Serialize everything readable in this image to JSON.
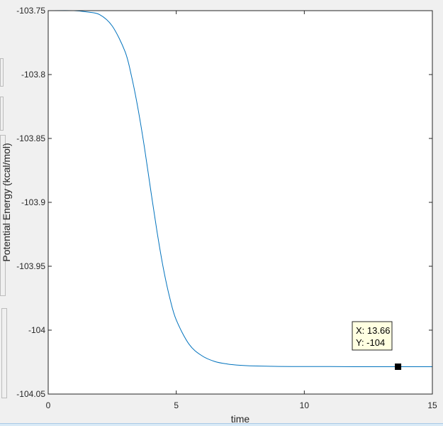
{
  "chart_data": {
    "type": "line",
    "title": "",
    "xlabel": "time",
    "ylabel": "Potential Energy (kcal/mol)",
    "xlim": [
      0,
      15
    ],
    "ylim": [
      -104.05,
      -103.75
    ],
    "xticks": [
      0,
      5,
      10,
      15
    ],
    "yticks": [
      -103.75,
      -103.8,
      -103.85,
      -103.9,
      -103.95,
      -104,
      -104.05
    ],
    "xtick_labels": [
      "0",
      "5",
      "10",
      "15"
    ],
    "ytick_labels": [
      "-103.75",
      "-103.8",
      "-103.85",
      "-103.9",
      "-103.95",
      "-104",
      "-104.05"
    ],
    "grid": false,
    "series": [
      {
        "color": "#0072bd",
        "x": [
          0,
          1,
          1.5,
          2,
          2.5,
          3,
          3.25,
          3.5,
          3.75,
          4,
          4.25,
          4.5,
          4.75,
          5,
          5.5,
          6,
          6.5,
          7,
          7.5,
          8,
          9,
          10,
          11,
          12,
          13,
          14,
          15
        ],
        "y": [
          -103.75,
          -103.75,
          -103.751,
          -103.753,
          -103.762,
          -103.782,
          -103.801,
          -103.826,
          -103.856,
          -103.89,
          -103.923,
          -103.952,
          -103.975,
          -103.992,
          -104.011,
          -104.02,
          -104.0245,
          -104.0265,
          -104.0275,
          -104.028,
          -104.0284,
          -104.0285,
          -104.0285,
          -104.0286,
          -104.0286,
          -104.0286,
          -104.0286
        ]
      }
    ],
    "datatip": {
      "x": 13.66,
      "y": -104.0286,
      "x_text": "X: 13.66",
      "y_text": "Y: -104"
    }
  }
}
